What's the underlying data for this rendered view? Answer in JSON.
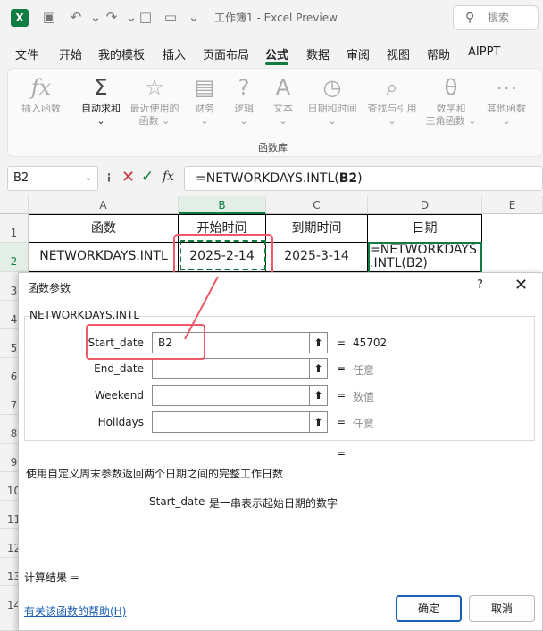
{
  "titlebar": {
    "title": "工作簿1 - Excel Preview",
    "search_placeholder": "搜索"
  },
  "menu": [
    "文件",
    "开始",
    "我的模板",
    "插入",
    "页面布局",
    "公式",
    "数据",
    "审阅",
    "视图",
    "帮助",
    "AIPPT"
  ],
  "menu_active": "公式",
  "ribbon": {
    "buttons": [
      {
        "icon": "fx",
        "label1": "插入函数",
        "label2": ""
      },
      {
        "icon": "Σ",
        "label1": "自动求和",
        "label2": "⌄"
      },
      {
        "icon": "☆",
        "label1": "最近使用的",
        "label2": "函数 ⌄"
      },
      {
        "icon": "▤",
        "label1": "财务",
        "label2": "⌄"
      },
      {
        "icon": "?",
        "label1": "逻辑",
        "label2": "⌄"
      },
      {
        "icon": "A",
        "label1": "文本",
        "label2": "⌄"
      },
      {
        "icon": "◷",
        "label1": "日期和时间",
        "label2": "⌄"
      },
      {
        "icon": "⌕",
        "label1": "查找与引用",
        "label2": "⌄"
      },
      {
        "icon": "θ",
        "label1": "数学和",
        "label2": "三角函数 ⌄"
      },
      {
        "icon": "⋯",
        "label1": "其他函数",
        "label2": "⌄"
      }
    ],
    "group_label": "函数库"
  },
  "formula_bar": {
    "name_box": "B2",
    "formula_prefix": "=NETWORKDAYS.INTL(",
    "formula_ref": "B2",
    "formula_suffix": ")"
  },
  "grid": {
    "columns": [
      "A",
      "B",
      "C",
      "D",
      "E"
    ],
    "rows": [
      "1",
      "2",
      "3",
      "4",
      "5",
      "6",
      "7",
      "8",
      "9",
      "10",
      "11",
      "12",
      "13",
      "14"
    ],
    "header_row": [
      "函数",
      "开始时间",
      "到期时间",
      "日期"
    ],
    "data_row": [
      "NETWORKDAYS.INTL",
      "2025-2-14",
      "2025-3-14"
    ],
    "d2_line1": "=NETWORKDAYS",
    "d2_line2": ".INTL(B2)"
  },
  "dialog": {
    "title": "函数参数",
    "help_char": "?",
    "function_name": "NETWORKDAYS.INTL",
    "args": [
      {
        "label": "Start_date",
        "value": "B2",
        "result": "45702"
      },
      {
        "label": "End_date",
        "value": "",
        "result": "任意"
      },
      {
        "label": "Weekend",
        "value": "",
        "result": "数值"
      },
      {
        "label": "Holidays",
        "value": "",
        "result": "任意"
      }
    ],
    "result_eq": "=",
    "description": "使用自定义周末参数返回两个日期之间的完整工作日数",
    "arg_desc_name": "Start_date",
    "arg_desc_text": "是一串表示起始日期的数字",
    "calc_result": "计算结果 =",
    "help_link": "有关该函数的帮助(H)",
    "ok": "确定",
    "cancel": "取消"
  }
}
